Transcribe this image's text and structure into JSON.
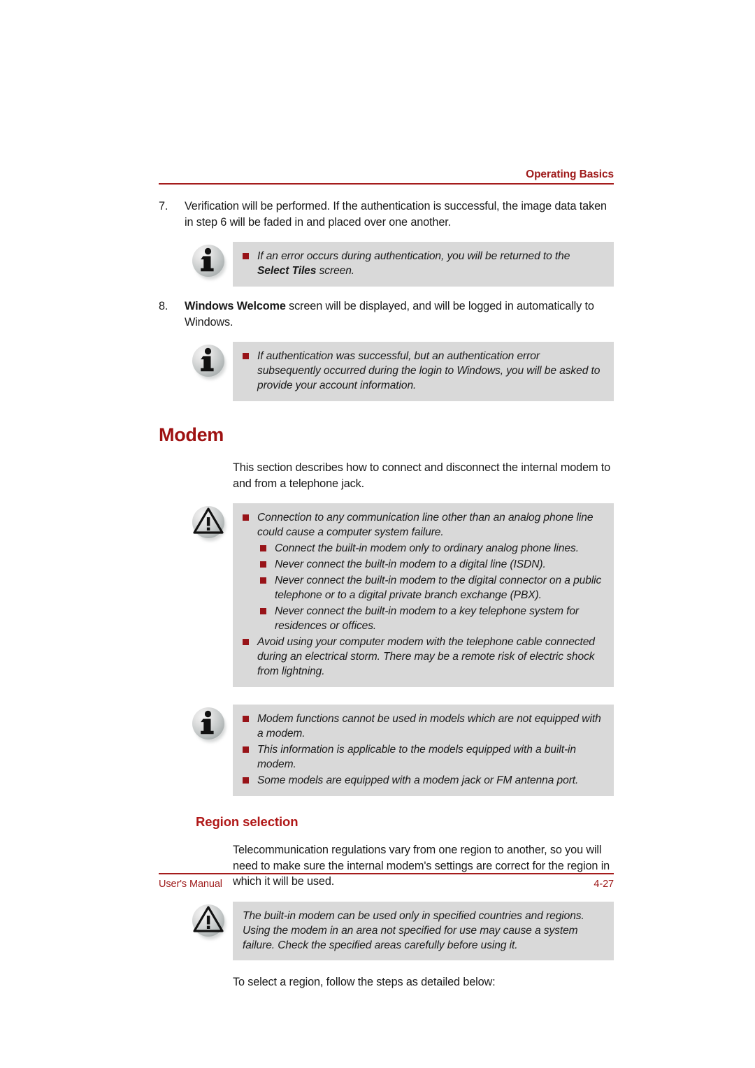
{
  "header": {
    "section_title": "Operating Basics"
  },
  "steps": [
    {
      "number": "7.",
      "line1": "Verification will be performed. If the authentication is successful, the",
      "line2": "image data taken in step 6 will be faded in and placed over one another."
    },
    {
      "number": "8.",
      "bold_lead": "Windows Welcome",
      "line1_rest": " screen will be displayed, and will be logged in",
      "line2": "automatically to Windows."
    }
  ],
  "callouts": {
    "info_select_tiles": {
      "icon": "info-icon",
      "bullets": [
        {
          "text_before_bold": "If an error occurs during authentication, you will be returned to the ",
          "bold": "Select Tiles",
          "text_after_bold": " screen."
        }
      ]
    },
    "info_auth_error": {
      "icon": "info-icon",
      "bullets": [
        {
          "text": "If authentication was successful, but an authentication error subsequently occurred during the login to Windows, you will be asked to provide your account information."
        }
      ]
    },
    "caution_modem": {
      "icon": "warning-icon",
      "bullets": [
        {
          "level": "top",
          "text": "Connection to any communication line other than an analog phone line could cause a computer system failure."
        },
        {
          "level": "sub",
          "text": "Connect the built-in modem only to ordinary analog phone lines."
        },
        {
          "level": "sub",
          "text": "Never connect the built-in modem to a digital line (ISDN)."
        },
        {
          "level": "sub",
          "text": "Never connect the built-in modem to the digital connector on a public telephone or to a digital private branch exchange (PBX)."
        },
        {
          "level": "sub",
          "text": "Never connect the built-in modem to a key telephone system for residences or offices."
        },
        {
          "level": "top",
          "text": "Avoid using your computer modem with the telephone cable connected during an electrical storm. There may be a remote risk of electric shock from lightning."
        }
      ]
    },
    "info_modem_models": {
      "icon": "info-icon",
      "bullets": [
        {
          "text": "Modem functions cannot be used in models which are not equipped with a modem."
        },
        {
          "text": "This information is applicable to the models equipped with a built-in modem."
        },
        {
          "text": "Some models are equipped with a modem jack or FM antenna port."
        }
      ]
    },
    "caution_region": {
      "icon": "warning-icon",
      "paragraph": "The built-in modem can be used only in specified countries and regions. Using the modem in an area not specified for use may cause a system failure. Check the specified areas carefully before using it."
    }
  },
  "headings": {
    "modem": "Modem",
    "region_selection": "Region selection"
  },
  "body_paragraphs": {
    "modem_intro_line1": "This section describes how to connect and disconnect the internal modem",
    "modem_intro_line2": "to and from a telephone jack.",
    "region_intro_line1": "Telecommunication regulations vary from one region to another, so you will",
    "region_intro_line2": "need to make sure the internal modem's settings are correct for the region",
    "region_intro_line3": "in which it will be used.",
    "region_steps_lead": "To select a region, follow the steps as detailed below:"
  },
  "footer": {
    "left": "User's Manual",
    "right": "4-27"
  },
  "colors": {
    "accent_red": "#9e1a1a",
    "heading_red": "#9e1111",
    "subheading_red": "#b01818",
    "bullet_red": "#981318",
    "callout_bg": "#d9d9d9"
  }
}
